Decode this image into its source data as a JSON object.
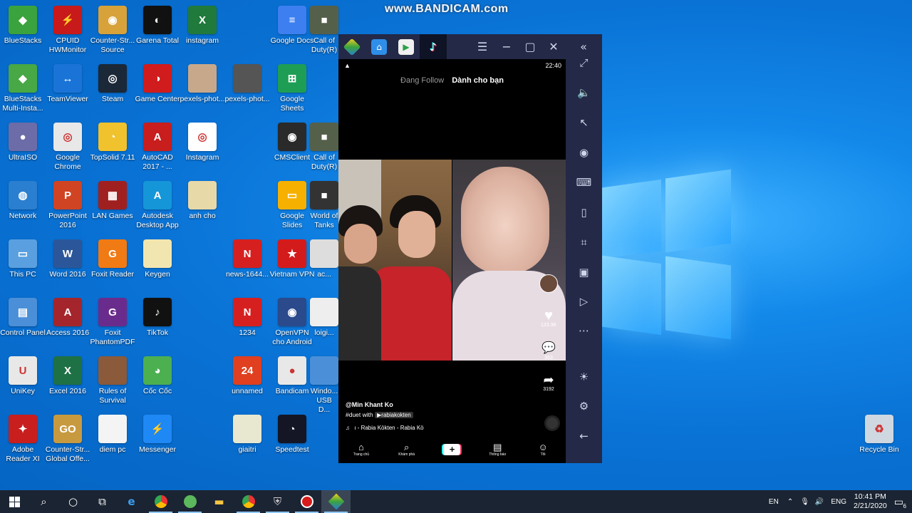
{
  "watermark": "www.BANDICAM.com",
  "desktop_icons": [
    {
      "label": "BlueStacks",
      "color": "#3aa33d",
      "glyph": "◆"
    },
    {
      "label": "CPUID HWMonitor",
      "color": "#c81a1a",
      "glyph": "⚡"
    },
    {
      "label": "Counter-Str... Source",
      "color": "#d8a23a",
      "glyph": "◉"
    },
    {
      "label": "Garena Total",
      "color": "#111111",
      "glyph": "◐"
    },
    {
      "label": "instagram",
      "color": "#1f7a3c",
      "glyph": "X"
    },
    {
      "label": "Google Docs",
      "color": "#3d7ff0",
      "glyph": "≡"
    },
    {
      "label": "Call of Duty(R)",
      "color": "#55604a",
      "glyph": "■"
    },
    {
      "label": "BlueStacks Multi-Insta...",
      "color": "#47a845",
      "glyph": "◆"
    },
    {
      "label": "TeamViewer",
      "color": "#1a74d8",
      "glyph": "↔"
    },
    {
      "label": "Steam",
      "color": "#1b2838",
      "glyph": "◎"
    },
    {
      "label": "Game Center",
      "color": "#d01c1c",
      "glyph": "◑"
    },
    {
      "label": "pexels-phot...",
      "color": "#c8a88a",
      "glyph": ""
    },
    {
      "label": "pexels-phot...",
      "color": "#555555",
      "glyph": ""
    },
    {
      "label": "Google Sheets",
      "color": "#1e9e55",
      "glyph": "⊞"
    },
    {
      "label": "UltraISO",
      "color": "#6c6ca8",
      "glyph": "●"
    },
    {
      "label": "Google Chrome",
      "color": "#e8e8e8",
      "glyph": "◎"
    },
    {
      "label": "TopSolid 7.11",
      "color": "#f0c22d",
      "glyph": "◔"
    },
    {
      "label": "AutoCAD 2017 - ...",
      "color": "#c81e1e",
      "glyph": "A"
    },
    {
      "label": "Instagram",
      "color": "#ffffff",
      "glyph": "◎"
    },
    {
      "label": "CMSClient",
      "color": "#2a2a2a",
      "glyph": "◉"
    },
    {
      "label": "Call of Duty(R)",
      "color": "#55604a",
      "glyph": "■"
    },
    {
      "label": "Network",
      "color": "#2a7fd0",
      "glyph": "◍"
    },
    {
      "label": "PowerPoint 2016",
      "color": "#d04423",
      "glyph": "P"
    },
    {
      "label": "LAN Games",
      "color": "#a02020",
      "glyph": "▦"
    },
    {
      "label": "Autodesk Desktop App",
      "color": "#1596d8",
      "glyph": "A"
    },
    {
      "label": "anh cho",
      "color": "#e8d9a8",
      "glyph": ""
    },
    {
      "label": "Google Slides",
      "color": "#f6b000",
      "glyph": "▭"
    },
    {
      "label": "World of Tanks",
      "color": "#333333",
      "glyph": "■"
    },
    {
      "label": "This PC",
      "color": "#5aa0e0",
      "glyph": "▭"
    },
    {
      "label": "Word 2016",
      "color": "#2b579a",
      "glyph": "W"
    },
    {
      "label": "Foxit Reader",
      "color": "#f07a14",
      "glyph": "G"
    },
    {
      "label": "Keygen",
      "color": "#f2e6b0",
      "glyph": ""
    },
    {
      "label": "news-1644...",
      "color": "#d62020",
      "glyph": "N"
    },
    {
      "label": "Vietnam VPN",
      "color": "#d41b1b",
      "glyph": "★"
    },
    {
      "label": "ac...",
      "color": "#dddddd",
      "glyph": ""
    },
    {
      "label": "Control Panel",
      "color": "#4a8fd8",
      "glyph": "▤"
    },
    {
      "label": "Access 2016",
      "color": "#a4262c",
      "glyph": "A"
    },
    {
      "label": "Foxit PhantomPDF",
      "color": "#6a2c8c",
      "glyph": "G"
    },
    {
      "label": "TikTok",
      "color": "#111111",
      "glyph": "♪"
    },
    {
      "label": "1234",
      "color": "#d62020",
      "glyph": "N"
    },
    {
      "label": "OpenVPN cho Android",
      "color": "#2a4a8c",
      "glyph": "◉"
    },
    {
      "label": "loigi...",
      "color": "#eeeeee",
      "glyph": ""
    },
    {
      "label": "UniKey",
      "color": "#e8e8e8",
      "glyph": "U"
    },
    {
      "label": "Excel 2016",
      "color": "#1e7145",
      "glyph": "X"
    },
    {
      "label": "Rules of Survival",
      "color": "#8a5a3a",
      "glyph": ""
    },
    {
      "label": "Cốc Cốc",
      "color": "#4caf50",
      "glyph": "◕"
    },
    {
      "label": "unnamed",
      "color": "#e04020",
      "glyph": "24"
    },
    {
      "label": "Bandicam",
      "color": "#e8e8e8",
      "glyph": "●"
    },
    {
      "label": "Windo... USB D...",
      "color": "#4a8fd8",
      "glyph": ""
    },
    {
      "label": "Adobe Reader XI",
      "color": "#c81e1e",
      "glyph": "✦"
    },
    {
      "label": "Counter-Str... Global Offe...",
      "color": "#c89a40",
      "glyph": "GO"
    },
    {
      "label": "diem pc",
      "color": "#f4f4f4",
      "glyph": ""
    },
    {
      "label": "Messenger",
      "color": "#1e88f5",
      "glyph": "⚡"
    },
    {
      "label": "giaitri",
      "color": "#e8e8d0",
      "glyph": ""
    },
    {
      "label": "Speedtest",
      "color": "#141626",
      "glyph": "◔"
    },
    {
      "label": "Recycle Bin",
      "color": "#cfd8e0",
      "glyph": "♻"
    }
  ],
  "bluestacks": {
    "tabs": [
      {
        "name": "bluestacks-logo",
        "color": "#58b83c"
      },
      {
        "name": "home-tab",
        "color": "#2f8ee8"
      },
      {
        "name": "play-store-tab",
        "color": "#ffffff"
      },
      {
        "name": "tiktok-tab",
        "color": "#111111"
      }
    ],
    "title_controls": [
      "☰",
      "−",
      "▢",
      "✕",
      "«"
    ],
    "sidebar_buttons": [
      {
        "name": "fullscreen-icon",
        "glyph": "⤢"
      },
      {
        "name": "volume-icon",
        "glyph": "🔈"
      },
      {
        "name": "cursor-icon",
        "glyph": "↖"
      },
      {
        "name": "eye-icon",
        "glyph": "◉"
      },
      {
        "name": "keyboard-icon",
        "glyph": "⌨"
      },
      {
        "name": "phone-icon",
        "glyph": "▯"
      },
      {
        "name": "gamepad-icon",
        "glyph": "⌗"
      },
      {
        "name": "camera-icon",
        "glyph": "▣"
      },
      {
        "name": "record-icon",
        "glyph": "▷"
      },
      {
        "name": "more-icon",
        "glyph": "⋯"
      },
      {
        "name": "bulb-icon",
        "glyph": "☀"
      },
      {
        "name": "settings-icon",
        "glyph": "⚙"
      },
      {
        "name": "back-icon",
        "glyph": "←"
      }
    ]
  },
  "tiktok": {
    "time": "22:40",
    "tab_following": "Đang Follow",
    "tab_foryou": "Dành cho bạn",
    "like_count": "123.3K",
    "comment_count": "363",
    "share_count": "3192",
    "username": "@Min Khant Ko",
    "caption_prefix": "#duet with",
    "caption_mention": "▶rabiakokten",
    "music": "ı - Rabia Kökten - Rabia Kö",
    "nav": [
      {
        "label": "Trang chủ",
        "glyph": "⌂"
      },
      {
        "label": "Khám phá",
        "glyph": "⌕"
      },
      {
        "label": "",
        "glyph": "+"
      },
      {
        "label": "Thông báo",
        "glyph": "▤"
      },
      {
        "label": "Tôi",
        "glyph": "☺"
      }
    ]
  },
  "taskbar": {
    "lang": "EN",
    "input_lang": "ENG",
    "time": "10:41 PM",
    "date": "2/21/2020",
    "notifications": "6"
  }
}
